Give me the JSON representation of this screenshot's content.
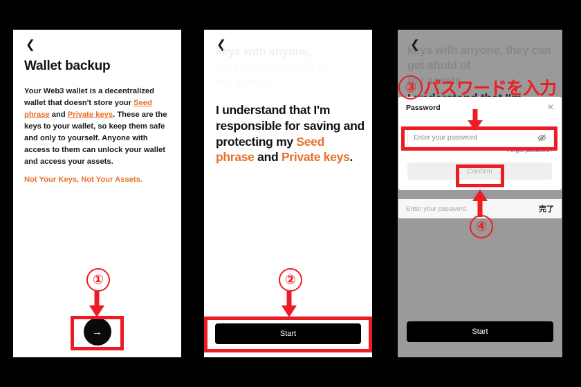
{
  "meta": {
    "background_color": "#000000",
    "accent_orange": "#E8702A",
    "annotation_red": "#ED1C24"
  },
  "panel1": {
    "back_icon": "chevron-left-icon",
    "title": "Wallet backup",
    "body": {
      "t1": "Your Web3 wallet is a decentralized wallet that doesn't store your ",
      "link1": "Seed phrase",
      "t2": " and ",
      "link2": "Private keys",
      "t3": ". These are the keys to your wallet, so keep them safe and only to yourself. Anyone with access to them can unlock your wallet and access your assets."
    },
    "warning": "Not Your Keys, Not Your Assets.",
    "next_button_icon": "arrow-right-icon"
  },
  "panel2": {
    "back_icon": "chevron-left-icon",
    "faded_line1": "keys with anyone,",
    "faded_line2": "they can get ahold of",
    "faded_line3": "my assets.",
    "statement": {
      "t1": "I understand that I'm responsible for saving and protecting my ",
      "orange1": "Seed phrase",
      "t2": " and ",
      "orange2": "Private keys",
      "t3": "."
    },
    "start_button": "Start"
  },
  "panel3": {
    "back_icon": "chevron-left-icon",
    "faded_line1": "keys with anyone, they can get ahold of",
    "faded_line2": "my assets.",
    "dimmed_statement": "I understand that I'm",
    "start_button": "Start",
    "dialog": {
      "title": "Password",
      "close_icon": "close-icon",
      "password_placeholder": "Enter your password",
      "password_value": "",
      "eye_icon": "eye-slash-icon",
      "forgot_link": "Forgot password?",
      "confirm_button": "Confirm"
    },
    "keyboard_bar": {
      "hint": "Enter your password",
      "done_label": "完了"
    }
  },
  "annotations": {
    "step1": "①",
    "step2": "②",
    "step3": "③",
    "step4": "④",
    "japanese_note": "パスワードを入力"
  }
}
